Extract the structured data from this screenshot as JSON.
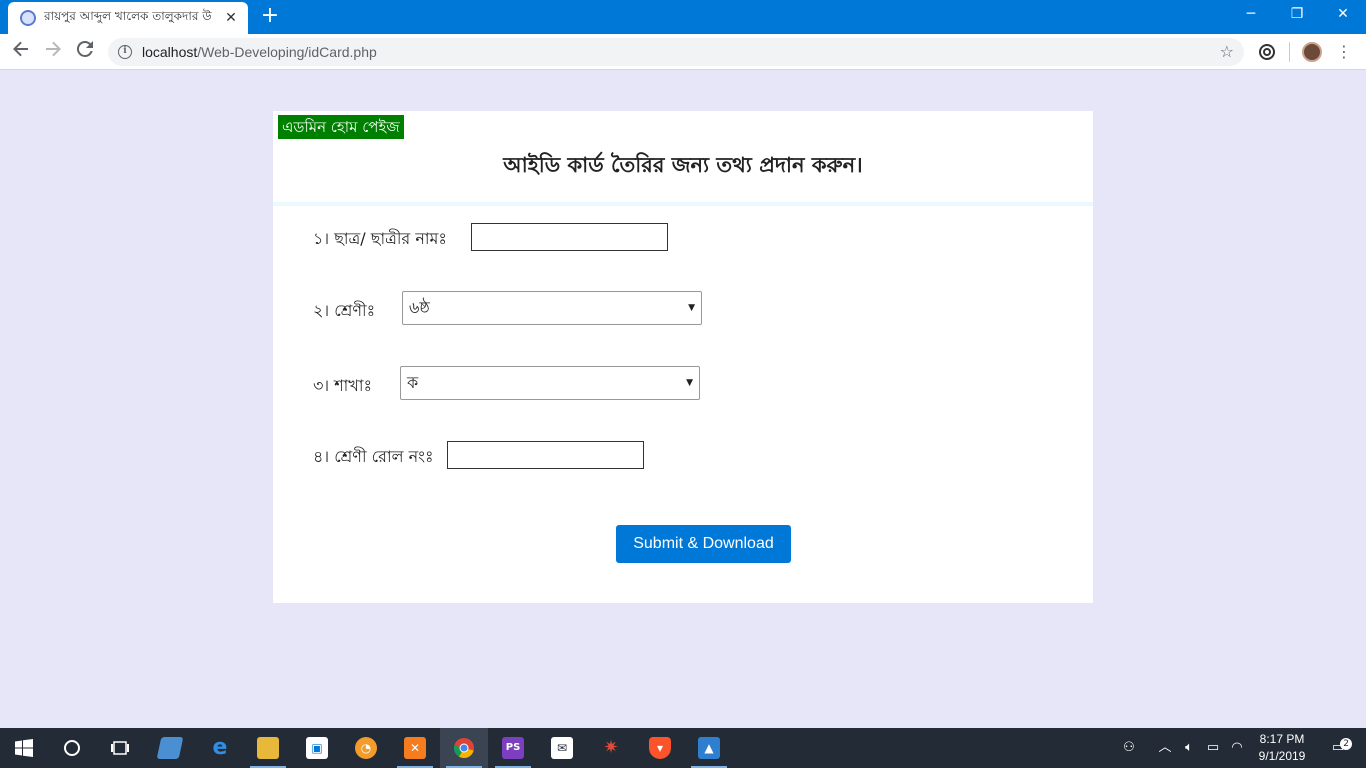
{
  "browser": {
    "tab_title": "রায়পুর আব্দুল খালেক তালুকদার উ",
    "new_tab": "+",
    "url_host": "localhost",
    "url_path": "/Web-Developing/idCard.php",
    "window_controls": {
      "minimize": "─",
      "restore": "❐",
      "close": "✕"
    }
  },
  "page": {
    "admin_link": "এডমিন হোম পেইজ",
    "heading": "আইডি কার্ড তৈরির জন্য তথ্য প্রদান করুন।",
    "fields": {
      "name_label": "১। ছাত্র/ ছাত্রীর নামঃ",
      "class_label": "২। শ্রেণীঃ",
      "class_value": "৬ষ্ঠ",
      "section_label": "৩। শাখাঃ",
      "section_value": "ক",
      "roll_label": "৪। শ্রেণী রোল নংঃ"
    },
    "submit_label": "Submit & Download"
  },
  "taskbar": {
    "time": "8:17 PM",
    "date": "9/1/2019",
    "notification_count": "2",
    "apps": [
      "start-icon",
      "cortana-icon",
      "task-view-icon",
      "tablet-icon",
      "edge-icon",
      "file-explorer-icon",
      "store-icon",
      "app-orange-icon",
      "xampp-icon",
      "chrome-icon",
      "phpstorm-icon",
      "mail-icon",
      "spider-icon",
      "brave-icon",
      "photos-icon"
    ]
  },
  "colors": {
    "titlebar": "#0078d7",
    "page_bg": "#e6e6f8",
    "admin_bg": "#008000",
    "submit_bg": "#0078d7"
  }
}
